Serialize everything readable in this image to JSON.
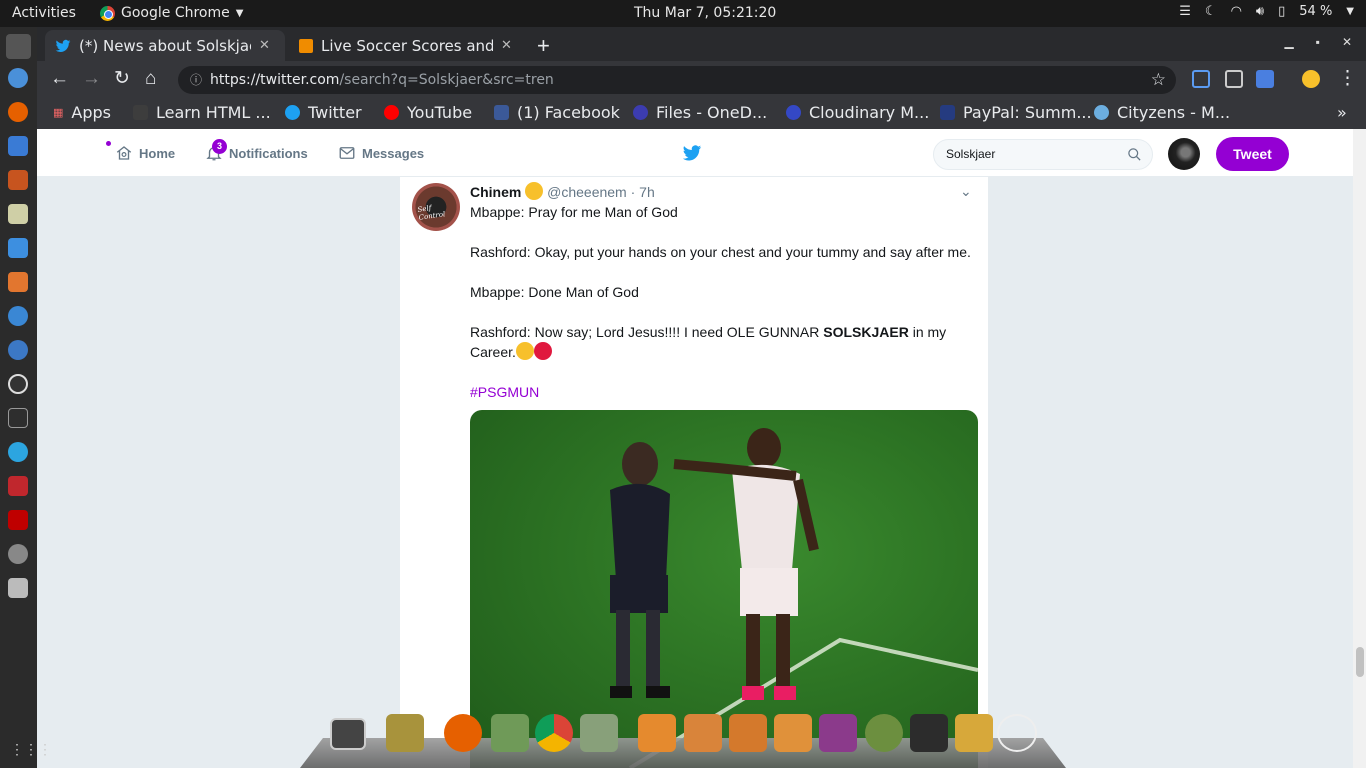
{
  "system": {
    "activities": "Activities",
    "app_name": "Google Chrome",
    "clock": "Thu Mar  7, 05:21:20",
    "battery": "54 %"
  },
  "browser": {
    "tabs": [
      {
        "title": "(*) News about Solskjaer",
        "active": true
      },
      {
        "title": "Live Soccer Scores and",
        "active": false
      }
    ],
    "url_host": "https://twitter.com",
    "url_path": "/search?q=Solskjaer&src=tren",
    "bookmarks": [
      "Apps",
      "Learn HTML ...",
      "Twitter",
      "YouTube",
      "(1) Facebook",
      "Files - OneD...",
      "Cloudinary M...",
      "PayPal: Summ...",
      "Cityzens - M..."
    ]
  },
  "twitter": {
    "nav": {
      "home": "Home",
      "notifications": "Notifications",
      "notification_count": "3",
      "messages": "Messages"
    },
    "search_value": "Solskjaer",
    "tweet_button": "Tweet",
    "tweet": {
      "name": "Chinem",
      "handle": "@cheeenem",
      "time": "· 7h",
      "lines": [
        "Mbappe: Pray for me Man of God",
        "Rashford: Okay, put your hands on your chest and your tummy and say after me.",
        "Mbappe: Done Man of God"
      ],
      "line4_pre": "Rashford: Now say; Lord Jesus!!!! I need OLE GUNNAR ",
      "line4_bold": "SOLSKJAER",
      "line4_post": " in my Career.",
      "hashtag": "#PSGMUN",
      "avatar_label": "Self Control"
    }
  },
  "colors": {
    "accent": "#9400d3",
    "twitter_blue": "#1da1f2"
  }
}
